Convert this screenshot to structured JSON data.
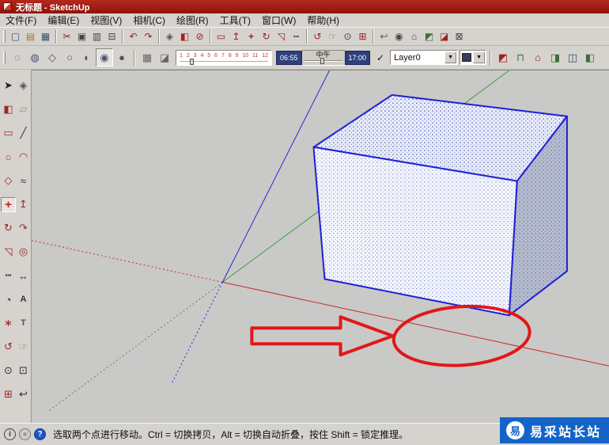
{
  "window": {
    "title": "无标题 - SketchUp"
  },
  "menubar": {
    "items": [
      "文件(F)",
      "编辑(E)",
      "视图(V)",
      "相机(C)",
      "绘图(R)",
      "工具(T)",
      "窗口(W)",
      "帮助(H)"
    ]
  },
  "toolbar_main": {
    "icons": [
      {
        "kind": "icon",
        "inter": "true",
        "name": "new-icon",
        "glyph": "▢",
        "style": "color:#35506e"
      },
      {
        "kind": "icon",
        "inter": "true",
        "name": "open-icon",
        "glyph": "▤",
        "style": "color:#a8791f"
      },
      {
        "kind": "icon",
        "inter": "true",
        "name": "save-icon",
        "glyph": "▦",
        "style": "color:#35506e"
      },
      {
        "kind": "sep",
        "inter": "false",
        "name": "separator"
      },
      {
        "kind": "icon",
        "inter": "true",
        "name": "cut-icon",
        "glyph": "✂",
        "style": "color:#8b2020"
      },
      {
        "kind": "icon",
        "inter": "true",
        "name": "copy-icon",
        "glyph": "▣",
        "style": "color:#444"
      },
      {
        "kind": "icon",
        "inter": "true",
        "name": "paste-icon",
        "glyph": "▥",
        "style": "color:#444"
      },
      {
        "kind": "icon",
        "inter": "true",
        "name": "print-icon",
        "glyph": "⊟",
        "style": "color:#444"
      },
      {
        "kind": "sep",
        "inter": "false",
        "name": "separator"
      },
      {
        "kind": "icon",
        "inter": "true",
        "name": "undo-icon",
        "glyph": "↶",
        "style": "color:#a02020"
      },
      {
        "kind": "icon",
        "inter": "true",
        "name": "redo-icon",
        "glyph": "↷",
        "style": "color:#a02020"
      },
      {
        "kind": "sep",
        "inter": "false",
        "name": "separator"
      },
      {
        "kind": "icon",
        "inter": "true",
        "name": "make-component-icon",
        "glyph": "◈",
        "style": "color:#555"
      },
      {
        "kind": "icon",
        "inter": "true",
        "name": "paint-bucket-icon",
        "glyph": "◧",
        "style": "color:#a02020"
      },
      {
        "kind": "icon",
        "inter": "true",
        "name": "eraser-icon",
        "glyph": "⊘",
        "style": "color:#a02020"
      },
      {
        "kind": "sep",
        "inter": "false",
        "name": "separator"
      },
      {
        "kind": "icon",
        "inter": "true",
        "name": "rectangle-icon",
        "glyph": "▭",
        "style": "color:#a02020"
      },
      {
        "kind": "icon",
        "inter": "true",
        "name": "push-pull-icon",
        "glyph": "↥",
        "style": "color:#a02020"
      },
      {
        "kind": "icon",
        "inter": "true",
        "name": "move-icon",
        "glyph": "+",
        "style": "color:#a02020;font-weight:bold"
      },
      {
        "kind": "icon",
        "inter": "true",
        "name": "rotate-icon",
        "glyph": "↻",
        "style": "color:#a02020"
      },
      {
        "kind": "icon",
        "inter": "true",
        "name": "scale-icon",
        "glyph": "◹",
        "style": "color:#a02020"
      },
      {
        "kind": "icon",
        "inter": "true",
        "name": "tape-measure-icon",
        "glyph": "┅",
        "style": "color:#444"
      },
      {
        "kind": "sep",
        "inter": "false",
        "name": "separator"
      },
      {
        "kind": "icon",
        "inter": "true",
        "name": "orbit-icon",
        "glyph": "↺",
        "style": "color:#a02020"
      },
      {
        "kind": "icon",
        "inter": "true",
        "name": "pan-icon",
        "glyph": "☞",
        "style": "color:#a8791f"
      },
      {
        "kind": "icon",
        "inter": "true",
        "name": "zoom-icon",
        "glyph": "⊙",
        "style": "color:#444"
      },
      {
        "kind": "icon",
        "inter": "true",
        "name": "zoom-extents-icon",
        "glyph": "⊞",
        "style": "color:#a02020"
      },
      {
        "kind": "sep",
        "inter": "false",
        "name": "separator"
      },
      {
        "kind": "icon",
        "inter": "true",
        "name": "previous-view-icon",
        "glyph": "↩",
        "style": "color:#3a6f3a"
      },
      {
        "kind": "icon",
        "inter": "true",
        "name": "camera-icon",
        "glyph": "◉",
        "style": "color:#444"
      },
      {
        "kind": "icon",
        "inter": "true",
        "name": "front-view-icon",
        "glyph": "⌂",
        "style": "color:#35506e"
      },
      {
        "kind": "icon",
        "inter": "true",
        "name": "iso-view-icon",
        "glyph": "◩",
        "style": "color:#3a6f3a"
      },
      {
        "kind": "icon",
        "inter": "true",
        "name": "section-plane-icon",
        "glyph": "◪",
        "style": "color:#a02020"
      },
      {
        "kind": "icon",
        "inter": "true",
        "name": "settings-icon",
        "glyph": "⊠",
        "style": "color:#444"
      }
    ]
  },
  "toolbar_second": {
    "face_style_buttons": [
      {
        "name": "xray-style-button",
        "glyph": "◌",
        "style": "color:#4a5570",
        "pressed": "false"
      },
      {
        "name": "back-edges-style-button",
        "glyph": "◍",
        "style": "color:#4a5570",
        "pressed": "false"
      },
      {
        "name": "wireframe-style-button",
        "glyph": "◇",
        "style": "color:#4a5570",
        "pressed": "false"
      },
      {
        "name": "hidden-line-style-button",
        "glyph": "○",
        "style": "color:#4a5570",
        "pressed": "false"
      },
      {
        "name": "shaded-style-button",
        "glyph": "◐",
        "style": "color:#4a5570",
        "pressed": "false"
      },
      {
        "name": "shaded-textures-style-button",
        "glyph": "◉",
        "style": "color:#4a5570",
        "pressed": "true"
      },
      {
        "name": "monochrome-style-button",
        "glyph": "●",
        "style": "color:#4a5570",
        "pressed": "false"
      }
    ],
    "shadow_buttons": [
      {
        "name": "shadow-dialog-button",
        "glyph": "▦",
        "style": "color:#666",
        "pressed": "false"
      },
      {
        "name": "shadow-toggle-button",
        "glyph": "◪",
        "style": "color:#666",
        "pressed": "false"
      }
    ],
    "date_slider": {
      "months": [
        "1",
        "2",
        "3",
        "4",
        "5",
        "6",
        "7",
        "8",
        "9",
        "10",
        "11",
        "12"
      ]
    },
    "time_slider": {
      "start": "06:55",
      "noon": "中午",
      "end": "17:00"
    },
    "layers": {
      "check_glyph": "✓",
      "current": "Layer0",
      "dropdown_glyph": "▼"
    },
    "view_buttons": [
      {
        "name": "iso-view-button",
        "glyph": "◩",
        "style": "color:#a02020",
        "pressed": "false"
      },
      {
        "name": "top-view-button",
        "glyph": "⊓",
        "style": "color:#3a6f3a",
        "pressed": "false"
      },
      {
        "name": "front-view-button",
        "glyph": "⌂",
        "style": "color:#a02020",
        "pressed": "false"
      },
      {
        "name": "right-view-button",
        "glyph": "◨",
        "style": "color:#3a6f3a",
        "pressed": "false"
      },
      {
        "name": "back-view-button",
        "glyph": "◫",
        "style": "color:#35506e",
        "pressed": "false"
      },
      {
        "name": "left-view-button",
        "glyph": "◧",
        "style": "color:#3a6f3a",
        "pressed": "false"
      }
    ]
  },
  "sidebar": {
    "tools": [
      {
        "name": "select-tool",
        "glyph": "➤",
        "style": "color:#222"
      },
      {
        "name": "make-component-tool",
        "glyph": "◈",
        "style": "color:#555"
      },
      {
        "name": "paint-bucket-tool",
        "glyph": "◧",
        "style": "color:#a02828"
      },
      {
        "name": "eraser-tool",
        "glyph": "▱",
        "style": "color:#b08968"
      },
      {
        "name": "rectangle-tool",
        "glyph": "▭",
        "style": "color:#a02828"
      },
      {
        "name": "line-tool",
        "glyph": "╱",
        "style": "color:#333"
      },
      {
        "name": "circle-tool",
        "glyph": "○",
        "style": "color:#a02828"
      },
      {
        "name": "arc-tool",
        "glyph": "◠",
        "style": "color:#a02828"
      },
      {
        "name": "polygon-tool",
        "glyph": "◇",
        "style": "color:#a02828"
      },
      {
        "name": "freehand-tool",
        "glyph": "≈",
        "style": "color:#333"
      },
      {
        "name": "move-tool",
        "glyph": "+",
        "style": "color:#c02020;font-weight:bold;font-size:15px",
        "pressed": "true"
      },
      {
        "name": "push-pull-tool",
        "glyph": "↥",
        "style": "color:#a02828"
      },
      {
        "name": "rotate-tool",
        "glyph": "↻",
        "style": "color:#a02828"
      },
      {
        "name": "follow-me-tool",
        "glyph": "↷",
        "style": "color:#a02828"
      },
      {
        "name": "scale-tool",
        "glyph": "◹",
        "style": "color:#a02828"
      },
      {
        "name": "offset-tool",
        "glyph": "◎",
        "style": "color:#a02828"
      },
      {
        "name": "tape-measure-tool",
        "glyph": "┅",
        "style": "color:#333"
      },
      {
        "name": "dimension-tool",
        "glyph": "↔",
        "style": "color:#333"
      },
      {
        "name": "protractor-tool",
        "glyph": "◔",
        "style": "color:#333"
      },
      {
        "name": "text-tool",
        "glyph": "A",
        "style": "color:#333;font-size:11px;font-weight:bold"
      },
      {
        "name": "axes-tool",
        "glyph": "∗",
        "style": "color:#a02828"
      },
      {
        "name": "3d-text-tool",
        "glyph": "T",
        "style": "color:#555;font-size:11px;font-weight:bold"
      },
      {
        "name": "orbit-tool",
        "glyph": "↺",
        "style": "color:#a02828"
      },
      {
        "name": "pan-tool",
        "glyph": "☞",
        "style": "color:#a8791f"
      },
      {
        "name": "zoom-tool",
        "glyph": "⊙",
        "style": "color:#333"
      },
      {
        "name": "zoom-window-tool",
        "glyph": "⊡",
        "style": "color:#333"
      },
      {
        "name": "zoom-extents-tool",
        "glyph": "⊞",
        "style": "color:#a02828"
      },
      {
        "name": "previous-view-tool",
        "glyph": "↩",
        "style": "color:#333"
      }
    ]
  },
  "statusbar": {
    "icons": [
      {
        "name": "info-icon",
        "glyph": "i",
        "style": "border:1px solid #444;color:#333;background:#d6d3ce"
      },
      {
        "name": "status-circle-icon",
        "glyph": "●",
        "style": "border:1px solid #777;color:#999;background:#cfccc7"
      },
      {
        "name": "question-icon",
        "glyph": "?",
        "style": "background:#1a55c8;color:#fff;border:1px solid #0d3a90"
      }
    ],
    "hint": "选取两个点进行移动。Ctrl = 切换拷贝，Alt = 切换自动折叠，按住 Shift = 锁定推理。"
  },
  "watermark": {
    "logo_char": "易",
    "text": "易采站长站",
    "color": "#1464c8"
  },
  "canvas_colors": {
    "background": "#c9c9c7",
    "axis_red": "#cc2a2a",
    "axis_green": "#3d9e3d",
    "axis_blue": "#2a2ad0",
    "selection_edge_blue": "#1f1fd6",
    "annotation_red": "#e01818"
  }
}
